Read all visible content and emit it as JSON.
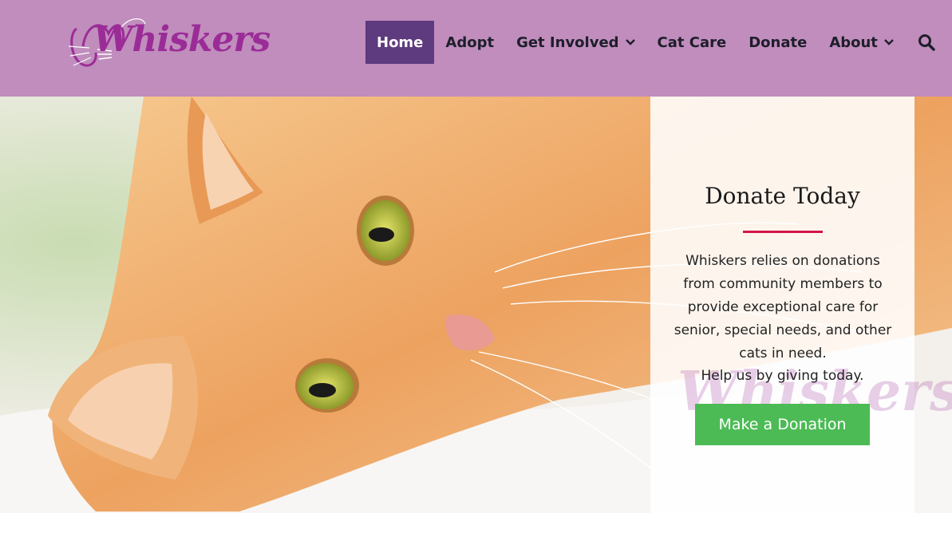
{
  "brand": {
    "logo_text": "Whiskers",
    "color": "#9b2c97"
  },
  "nav": {
    "items": [
      {
        "label": "Home",
        "active": true
      },
      {
        "label": "Adopt"
      },
      {
        "label": "Get Involved",
        "has_dropdown": true
      },
      {
        "label": "Cat Care"
      },
      {
        "label": "Donate"
      },
      {
        "label": "About",
        "has_dropdown": true
      }
    ],
    "search_icon": "search-icon"
  },
  "hero": {
    "image": "orange tabby cat lying on a white blanket",
    "card": {
      "title": "Donate Today",
      "body": "Whiskers relies on donations from community members to provide exceptional care for senior, special needs, and other cats in need.",
      "body2": "Help us by giving today.",
      "button_label": "Make a Donation",
      "watermark_text": "Whiskers"
    }
  },
  "colors": {
    "header_bg": "#c08dbd",
    "nav_active_bg": "#5e3a7e",
    "accent_rule": "#d3154a",
    "button_bg": "#4cbb55"
  }
}
